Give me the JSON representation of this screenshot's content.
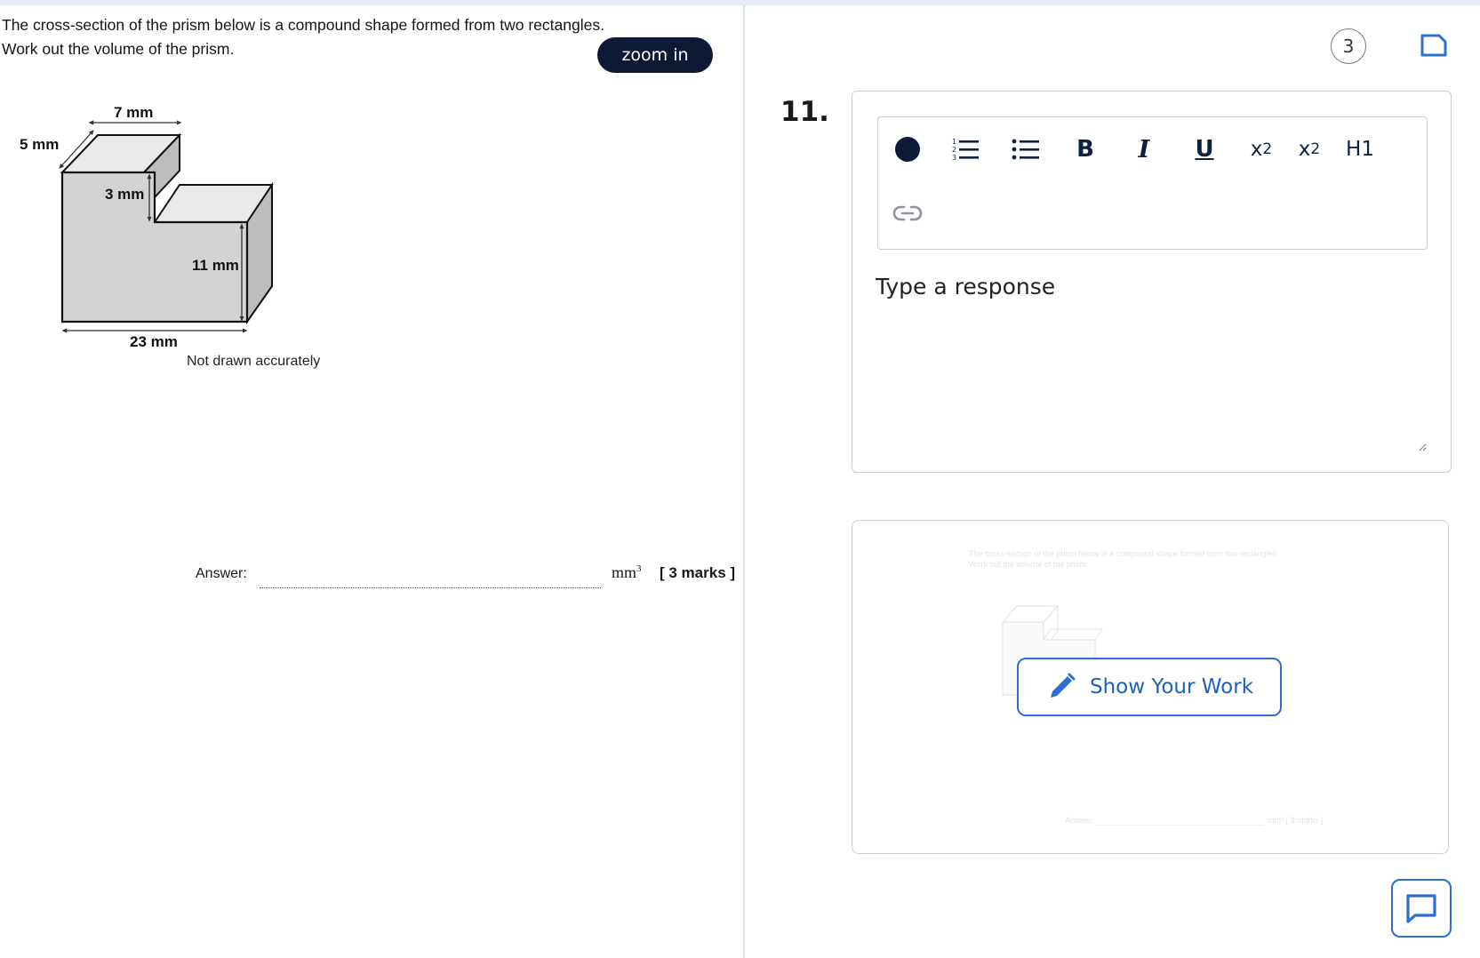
{
  "question": {
    "line1": "The cross-section of the prism below is a compound shape formed from two rectangles.",
    "line2": "Work out the volume of the prism.",
    "zoom_label": "zoom in",
    "diagram": {
      "top_width": "7 mm",
      "depth": "5 mm",
      "step_height": "3 mm",
      "right_height": "11 mm",
      "bottom_width": "23 mm",
      "note": "Not drawn accurately"
    },
    "answer_label": "Answer:",
    "unit": "mm",
    "unit_exp": "3",
    "marks": "[ 3 marks ]"
  },
  "header": {
    "page_number": "3"
  },
  "response": {
    "question_number": "11.",
    "toolbar": {
      "numbered_list": "numbered-list",
      "bullet_list": "bullet-list",
      "bold": "B",
      "italic": "I",
      "underline": "U",
      "subscript_base": "x",
      "subscript": "2",
      "superscript_base": "x",
      "superscript": "2",
      "heading": "H1"
    },
    "placeholder": "Type a response"
  },
  "work": {
    "ghost_line1": "The cross-section of the prism below is a compound shape formed from two rectangles.",
    "ghost_line2": "Work out the volume of the prism.",
    "ghost_answer": "Answer:",
    "ghost_marks": "mm³ [ 3 marks ]",
    "show_work_label": "Show Your Work"
  },
  "colors": {
    "accent": "#2c6fd1",
    "dark_button": "#0d1a35",
    "shape_fill": "#d3d3d3"
  }
}
